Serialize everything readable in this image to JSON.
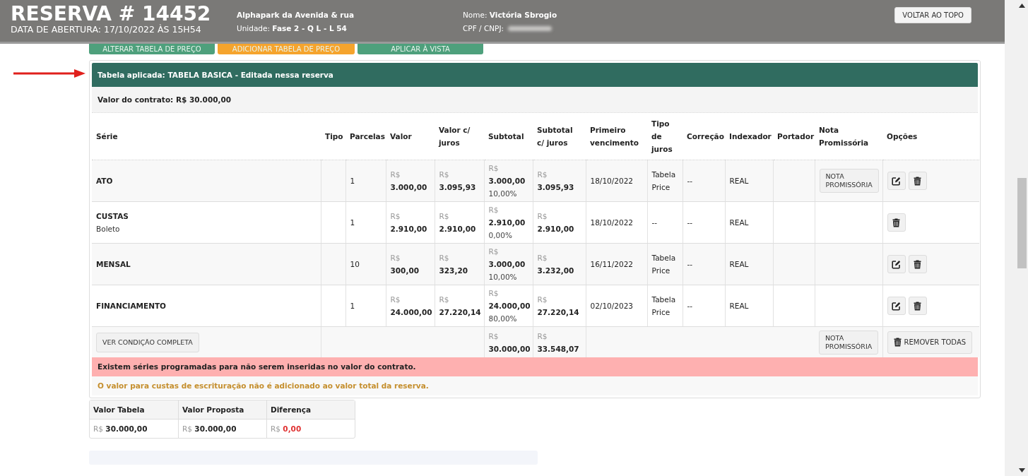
{
  "header": {
    "title": "RESERVA # 14452",
    "opened": "DATA DE ABERTURA: 17/10/2022 ÀS 15H54",
    "project": "Alphapark da Avenida & rua",
    "unit_label": "Unidade:",
    "unit": "Fase 2 - Q L - L 54",
    "name_label": "Nome:",
    "name": "Victória Sbrogio",
    "cpf_label": "CPF / CNPJ:",
    "back_to_top": "VOLTAR AO TOPO"
  },
  "actions": [
    {
      "label": "ALTERAR TABELA DE PREÇO",
      "kind": "primary"
    },
    {
      "label": "ADICIONAR TABELA DE PREÇO",
      "kind": "warning"
    },
    {
      "label": "APLICAR À VISTA",
      "kind": "primary"
    }
  ],
  "table_panel": {
    "title": "Tabela aplicada: TABELA BASICA - Editada nessa reserva",
    "contract_value": "Valor do contrato: R$ 30.000,00",
    "columns": [
      "Série",
      "Tipo",
      "Parcelas",
      "Valor",
      "Valor c/ juros",
      "Subtotal",
      "Subtotal c/ juros",
      "Primeiro vencimento",
      "Tipo de juros",
      "Correção",
      "Indexador",
      "Portador",
      "Nota Promissória",
      "Opções"
    ],
    "rows": [
      {
        "serie": "ATO",
        "parcelas": "1",
        "valor": {
          "currency": "R$",
          "amount": "3.000,00"
        },
        "valor_juros": {
          "currency": "R$",
          "amount": "3.095,93"
        },
        "subtotal": {
          "currency": "R$",
          "amount": "3.000,00",
          "percent": "10,00%"
        },
        "subtotal_juros": {
          "currency": "R$",
          "amount": "3.095,93"
        },
        "primeiro_vencimento": "18/10/2022",
        "tipo_juros": "Tabela Price",
        "correcao": "--",
        "indexador": "REAL",
        "nota_promissoria": "NOTA PROMISSÓRIA",
        "editable": true
      },
      {
        "serie": "CUSTAS",
        "subtitle": "Boleto",
        "parcelas": "1",
        "valor": {
          "currency": "R$",
          "amount": "2.910,00"
        },
        "valor_juros": {
          "currency": "R$",
          "amount": "2.910,00"
        },
        "subtotal": {
          "currency": "R$",
          "amount": "2.910,00",
          "percent": "0,00%"
        },
        "subtotal_juros": {
          "currency": "R$",
          "amount": "2.910,00"
        },
        "primeiro_vencimento": "18/10/2022",
        "tipo_juros": "--",
        "correcao": "--",
        "indexador": "REAL",
        "editable": false
      },
      {
        "serie": "MENSAL",
        "parcelas": "10",
        "valor": {
          "currency": "R$",
          "amount": "300,00"
        },
        "valor_juros": {
          "currency": "R$",
          "amount": "323,20"
        },
        "subtotal": {
          "currency": "R$",
          "amount": "3.000,00",
          "percent": "10,00%"
        },
        "subtotal_juros": {
          "currency": "R$",
          "amount": "3.232,00"
        },
        "primeiro_vencimento": "16/11/2022",
        "tipo_juros": "Tabela Price",
        "correcao": "--",
        "indexador": "REAL",
        "editable": true
      },
      {
        "serie": "FINANCIAMENTO",
        "parcelas": "1",
        "valor": {
          "currency": "R$",
          "amount": "24.000,00"
        },
        "valor_juros": {
          "currency": "R$",
          "amount": "27.220,14"
        },
        "subtotal": {
          "currency": "R$",
          "amount": "24.000,00",
          "percent": "80,00%"
        },
        "subtotal_juros": {
          "currency": "R$",
          "amount": "27.220,14"
        },
        "primeiro_vencimento": "02/10/2023",
        "tipo_juros": "Tabela Price",
        "correcao": "--",
        "indexador": "REAL",
        "editable": true
      }
    ],
    "footer": {
      "full_condition": "VER CONDIÇÃO COMPLETA",
      "subtotal": {
        "currency": "R$",
        "amount": "30.000,00"
      },
      "subtotal_juros": {
        "currency": "R$",
        "amount": "33.548,07"
      },
      "nota_promissoria": "NOTA PROMISSÓRIA",
      "remove_all": "REMOVER TODAS"
    },
    "alert": "Existem séries programadas para não serem inseridas no valor do contrato.",
    "note": "O valor para custas de escrituração não é adicionado ao valor total da reserva."
  },
  "summary": {
    "columns": [
      "Valor Tabela",
      "Valor Proposta",
      "Diferença"
    ],
    "values": [
      {
        "currency": "R$",
        "amount": "30.000,00",
        "highlight": false
      },
      {
        "currency": "R$",
        "amount": "30.000,00",
        "highlight": false
      },
      {
        "currency": "R$",
        "amount": "0,00",
        "highlight": true
      }
    ]
  }
}
